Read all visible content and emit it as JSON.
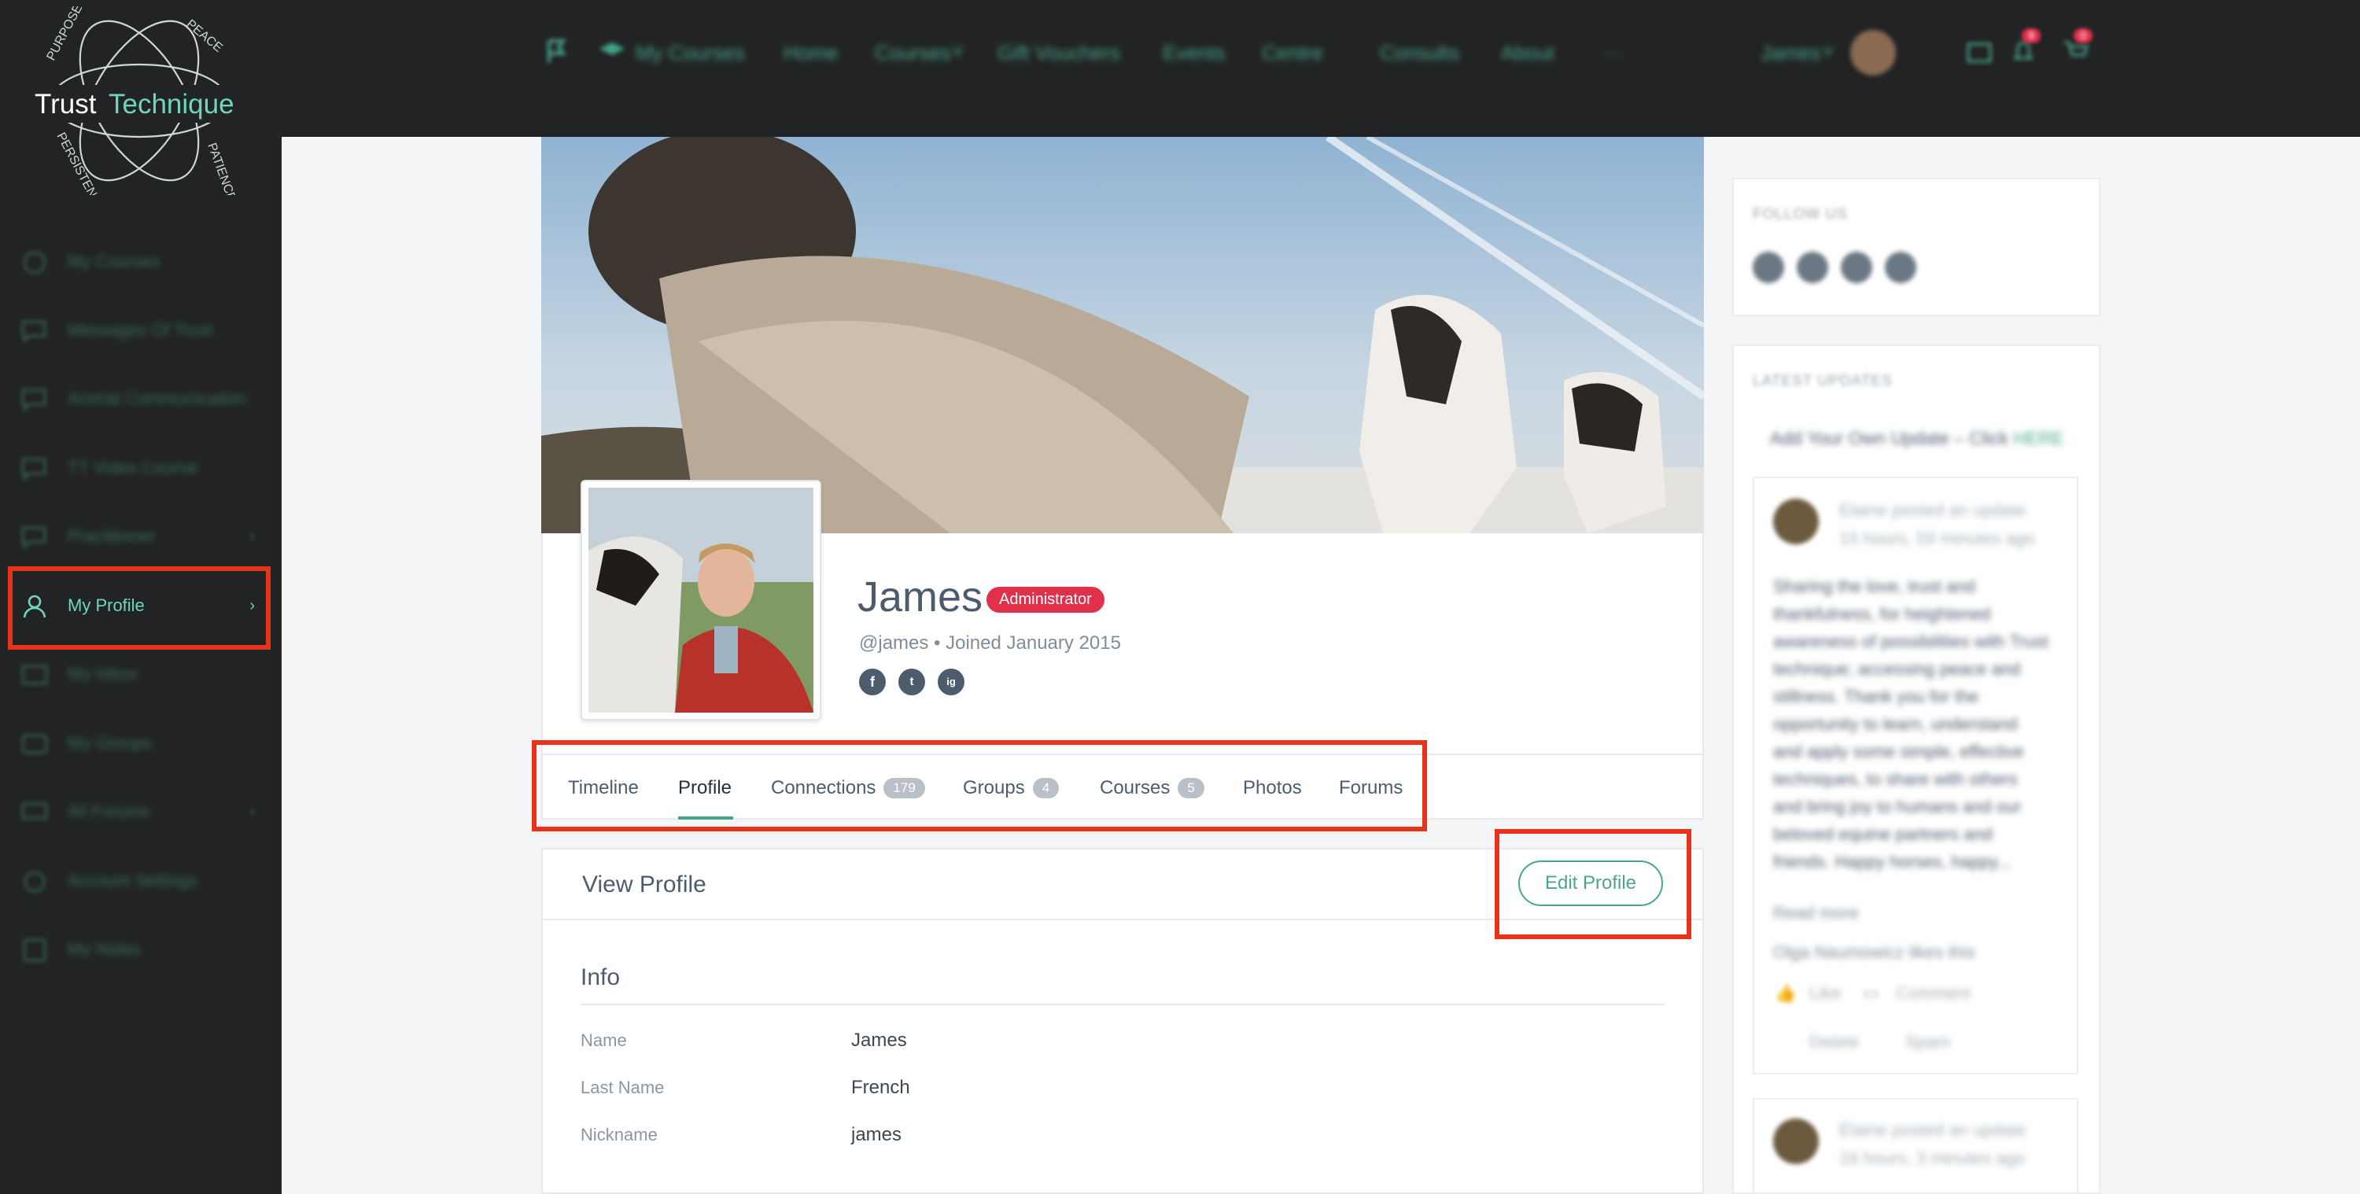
{
  "brand": {
    "name_primary": "Trust",
    "name_secondary": "Technique",
    "ring_words": [
      "PURPOSE",
      "PEACE",
      "PATIENCE",
      "PERSISTENCE"
    ]
  },
  "sidebar": {
    "items": [
      {
        "label": "My Courses",
        "icon": "graduation-cap-icon",
        "chevron": false
      },
      {
        "label": "Messages Of Trust",
        "icon": "chat-bubble-icon",
        "chevron": false
      },
      {
        "label": "Animal Communication",
        "icon": "chat-bubble-icon",
        "chevron": false
      },
      {
        "label": "TT Video Course",
        "icon": "chat-bubble-icon",
        "chevron": false
      },
      {
        "label": "Practitioner",
        "icon": "chat-bubble-icon",
        "chevron": true
      },
      {
        "label": "My Profile",
        "icon": "user-icon",
        "chevron": true,
        "active": true
      },
      {
        "label": "My Inbox",
        "icon": "inbox-icon",
        "chevron": false
      },
      {
        "label": "My Groups",
        "icon": "groups-icon",
        "chevron": false
      },
      {
        "label": "All Forums",
        "icon": "forum-icon",
        "chevron": true
      },
      {
        "label": "Account Settings",
        "icon": "gear-icon",
        "chevron": false
      },
      {
        "label": "My Notes",
        "icon": "notes-icon",
        "chevron": false
      }
    ]
  },
  "topnav": {
    "links": [
      "My Courses",
      "Home",
      "Courses",
      "Gift Vouchers",
      "Events",
      "Centre",
      "Consults",
      "About",
      "···"
    ],
    "user_name": "James",
    "notification_count": "9",
    "cart_count": "0"
  },
  "profile": {
    "name": "James",
    "role": "Administrator",
    "handle_line": "@james • Joined January 2015",
    "social": [
      "f",
      "t",
      "ig"
    ]
  },
  "tabs": [
    {
      "label": "Timeline"
    },
    {
      "label": "Profile",
      "active": true
    },
    {
      "label": "Connections",
      "count": "179"
    },
    {
      "label": "Groups",
      "count": "4"
    },
    {
      "label": "Courses",
      "count": "5"
    },
    {
      "label": "Photos"
    },
    {
      "label": "Forums"
    }
  ],
  "view_profile": {
    "title": "View Profile",
    "edit_label": "Edit Profile",
    "section_title": "Info",
    "rows": [
      {
        "label": "Name",
        "value": "James"
      },
      {
        "label": "Last Name",
        "value": "French"
      },
      {
        "label": "Nickname",
        "value": "james"
      }
    ]
  },
  "right": {
    "follow_title": "FOLLOW US",
    "updates_title": "LATEST UPDATES",
    "add_update_text": "Add Your Own Update – Click",
    "add_update_link": "HERE",
    "update1": {
      "author_line": "Elaine posted an update",
      "time": "15 hours, 59 minutes ago",
      "text": "Sharing the love, trust and thankfulness, for heightened awareness of possibilities with Trust technique; accessing peace and stillness. Thank you for the opportunity to learn, understand and apply some simple, effective techniques, to share with others and bring joy to humans and our beloved equine partners and friends. Happy horses, happy...",
      "read_more": "Read more",
      "likes": "Olga Naumowicz likes this",
      "like": "Like",
      "comment": "Comment",
      "delete": "Delete",
      "spam": "Spam"
    },
    "update2": {
      "author_line": "Elaine posted an update",
      "time": "16 hours, 3 minutes ago"
    }
  }
}
